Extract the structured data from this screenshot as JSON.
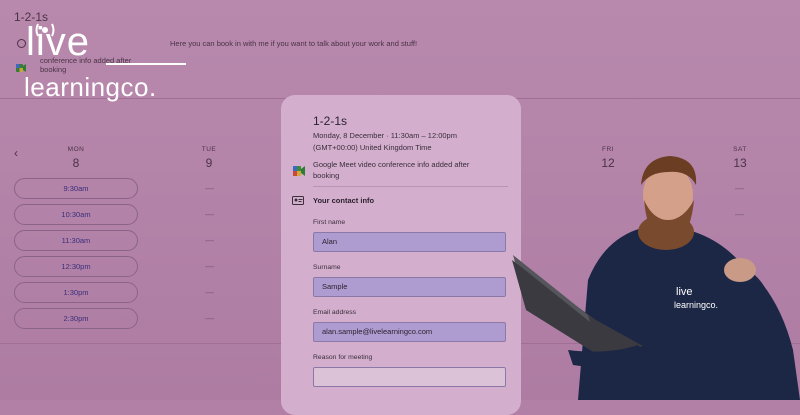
{
  "background": {
    "title": "1-2-1s",
    "description": "Here you can book in with me if you want to talk about your work and stuff!",
    "meeting_line": "conference info added after booking",
    "prev_icon": "chevron-left-icon",
    "days": [
      {
        "name": "MON",
        "date": "8"
      },
      {
        "name": "TUE",
        "date": "9"
      },
      {
        "name": "FRI",
        "date": "12"
      },
      {
        "name": "SAT",
        "date": "13"
      }
    ],
    "slots": [
      "9:30am",
      "10:30am",
      "11:30am",
      "12:30pm",
      "1:30pm",
      "2:30pm"
    ]
  },
  "logo": {
    "word1": "live",
    "word2": "learningco."
  },
  "booking": {
    "title": "1-2-1s",
    "date_time": "Monday, 8 December · 11:30am – 12:00pm",
    "timezone": "(GMT+00:00) United Kingdom Time",
    "meet_info": "Google Meet video conference info added after booking",
    "contact_heading": "Your contact info",
    "fields": {
      "first_name": {
        "label": "First name",
        "value": "Alan"
      },
      "surname": {
        "label": "Surname",
        "value": "Sample"
      },
      "email": {
        "label": "Email address",
        "value": "alan.sample@livelearningco.com"
      },
      "reason": {
        "label": "Reason for meeting",
        "value": ""
      }
    }
  },
  "presenter": {
    "hoodie_text1": "live",
    "hoodie_text2": "learningco."
  },
  "colors": {
    "overlay": "#b27fa6",
    "card": "#d3afcd",
    "field_fill": "#ae9bcf",
    "slot_text": "#3a2f7a"
  }
}
